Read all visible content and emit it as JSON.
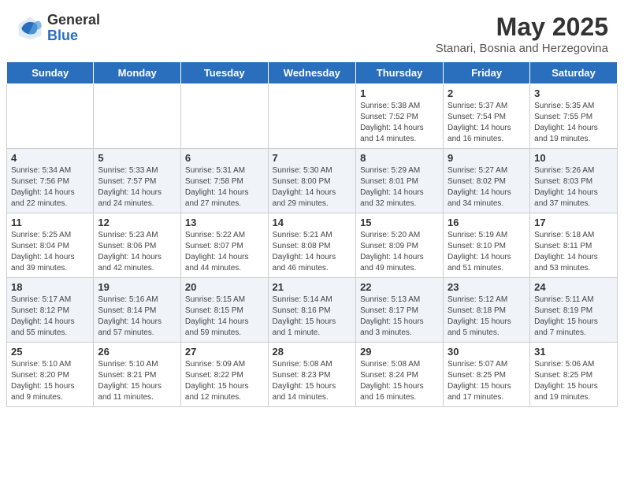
{
  "header": {
    "logo_general": "General",
    "logo_blue": "Blue",
    "month_year": "May 2025",
    "location": "Stanari, Bosnia and Herzegovina"
  },
  "days_of_week": [
    "Sunday",
    "Monday",
    "Tuesday",
    "Wednesday",
    "Thursday",
    "Friday",
    "Saturday"
  ],
  "weeks": [
    [
      {
        "day": "",
        "info": ""
      },
      {
        "day": "",
        "info": ""
      },
      {
        "day": "",
        "info": ""
      },
      {
        "day": "",
        "info": ""
      },
      {
        "day": "1",
        "info": "Sunrise: 5:38 AM\nSunset: 7:52 PM\nDaylight: 14 hours\nand 14 minutes."
      },
      {
        "day": "2",
        "info": "Sunrise: 5:37 AM\nSunset: 7:54 PM\nDaylight: 14 hours\nand 16 minutes."
      },
      {
        "day": "3",
        "info": "Sunrise: 5:35 AM\nSunset: 7:55 PM\nDaylight: 14 hours\nand 19 minutes."
      }
    ],
    [
      {
        "day": "4",
        "info": "Sunrise: 5:34 AM\nSunset: 7:56 PM\nDaylight: 14 hours\nand 22 minutes."
      },
      {
        "day": "5",
        "info": "Sunrise: 5:33 AM\nSunset: 7:57 PM\nDaylight: 14 hours\nand 24 minutes."
      },
      {
        "day": "6",
        "info": "Sunrise: 5:31 AM\nSunset: 7:58 PM\nDaylight: 14 hours\nand 27 minutes."
      },
      {
        "day": "7",
        "info": "Sunrise: 5:30 AM\nSunset: 8:00 PM\nDaylight: 14 hours\nand 29 minutes."
      },
      {
        "day": "8",
        "info": "Sunrise: 5:29 AM\nSunset: 8:01 PM\nDaylight: 14 hours\nand 32 minutes."
      },
      {
        "day": "9",
        "info": "Sunrise: 5:27 AM\nSunset: 8:02 PM\nDaylight: 14 hours\nand 34 minutes."
      },
      {
        "day": "10",
        "info": "Sunrise: 5:26 AM\nSunset: 8:03 PM\nDaylight: 14 hours\nand 37 minutes."
      }
    ],
    [
      {
        "day": "11",
        "info": "Sunrise: 5:25 AM\nSunset: 8:04 PM\nDaylight: 14 hours\nand 39 minutes."
      },
      {
        "day": "12",
        "info": "Sunrise: 5:23 AM\nSunset: 8:06 PM\nDaylight: 14 hours\nand 42 minutes."
      },
      {
        "day": "13",
        "info": "Sunrise: 5:22 AM\nSunset: 8:07 PM\nDaylight: 14 hours\nand 44 minutes."
      },
      {
        "day": "14",
        "info": "Sunrise: 5:21 AM\nSunset: 8:08 PM\nDaylight: 14 hours\nand 46 minutes."
      },
      {
        "day": "15",
        "info": "Sunrise: 5:20 AM\nSunset: 8:09 PM\nDaylight: 14 hours\nand 49 minutes."
      },
      {
        "day": "16",
        "info": "Sunrise: 5:19 AM\nSunset: 8:10 PM\nDaylight: 14 hours\nand 51 minutes."
      },
      {
        "day": "17",
        "info": "Sunrise: 5:18 AM\nSunset: 8:11 PM\nDaylight: 14 hours\nand 53 minutes."
      }
    ],
    [
      {
        "day": "18",
        "info": "Sunrise: 5:17 AM\nSunset: 8:12 PM\nDaylight: 14 hours\nand 55 minutes."
      },
      {
        "day": "19",
        "info": "Sunrise: 5:16 AM\nSunset: 8:14 PM\nDaylight: 14 hours\nand 57 minutes."
      },
      {
        "day": "20",
        "info": "Sunrise: 5:15 AM\nSunset: 8:15 PM\nDaylight: 14 hours\nand 59 minutes."
      },
      {
        "day": "21",
        "info": "Sunrise: 5:14 AM\nSunset: 8:16 PM\nDaylight: 15 hours\nand 1 minute."
      },
      {
        "day": "22",
        "info": "Sunrise: 5:13 AM\nSunset: 8:17 PM\nDaylight: 15 hours\nand 3 minutes."
      },
      {
        "day": "23",
        "info": "Sunrise: 5:12 AM\nSunset: 8:18 PM\nDaylight: 15 hours\nand 5 minutes."
      },
      {
        "day": "24",
        "info": "Sunrise: 5:11 AM\nSunset: 8:19 PM\nDaylight: 15 hours\nand 7 minutes."
      }
    ],
    [
      {
        "day": "25",
        "info": "Sunrise: 5:10 AM\nSunset: 8:20 PM\nDaylight: 15 hours\nand 9 minutes."
      },
      {
        "day": "26",
        "info": "Sunrise: 5:10 AM\nSunset: 8:21 PM\nDaylight: 15 hours\nand 11 minutes."
      },
      {
        "day": "27",
        "info": "Sunrise: 5:09 AM\nSunset: 8:22 PM\nDaylight: 15 hours\nand 12 minutes."
      },
      {
        "day": "28",
        "info": "Sunrise: 5:08 AM\nSunset: 8:23 PM\nDaylight: 15 hours\nand 14 minutes."
      },
      {
        "day": "29",
        "info": "Sunrise: 5:08 AM\nSunset: 8:24 PM\nDaylight: 15 hours\nand 16 minutes."
      },
      {
        "day": "30",
        "info": "Sunrise: 5:07 AM\nSunset: 8:25 PM\nDaylight: 15 hours\nand 17 minutes."
      },
      {
        "day": "31",
        "info": "Sunrise: 5:06 AM\nSunset: 8:25 PM\nDaylight: 15 hours\nand 19 minutes."
      }
    ]
  ]
}
